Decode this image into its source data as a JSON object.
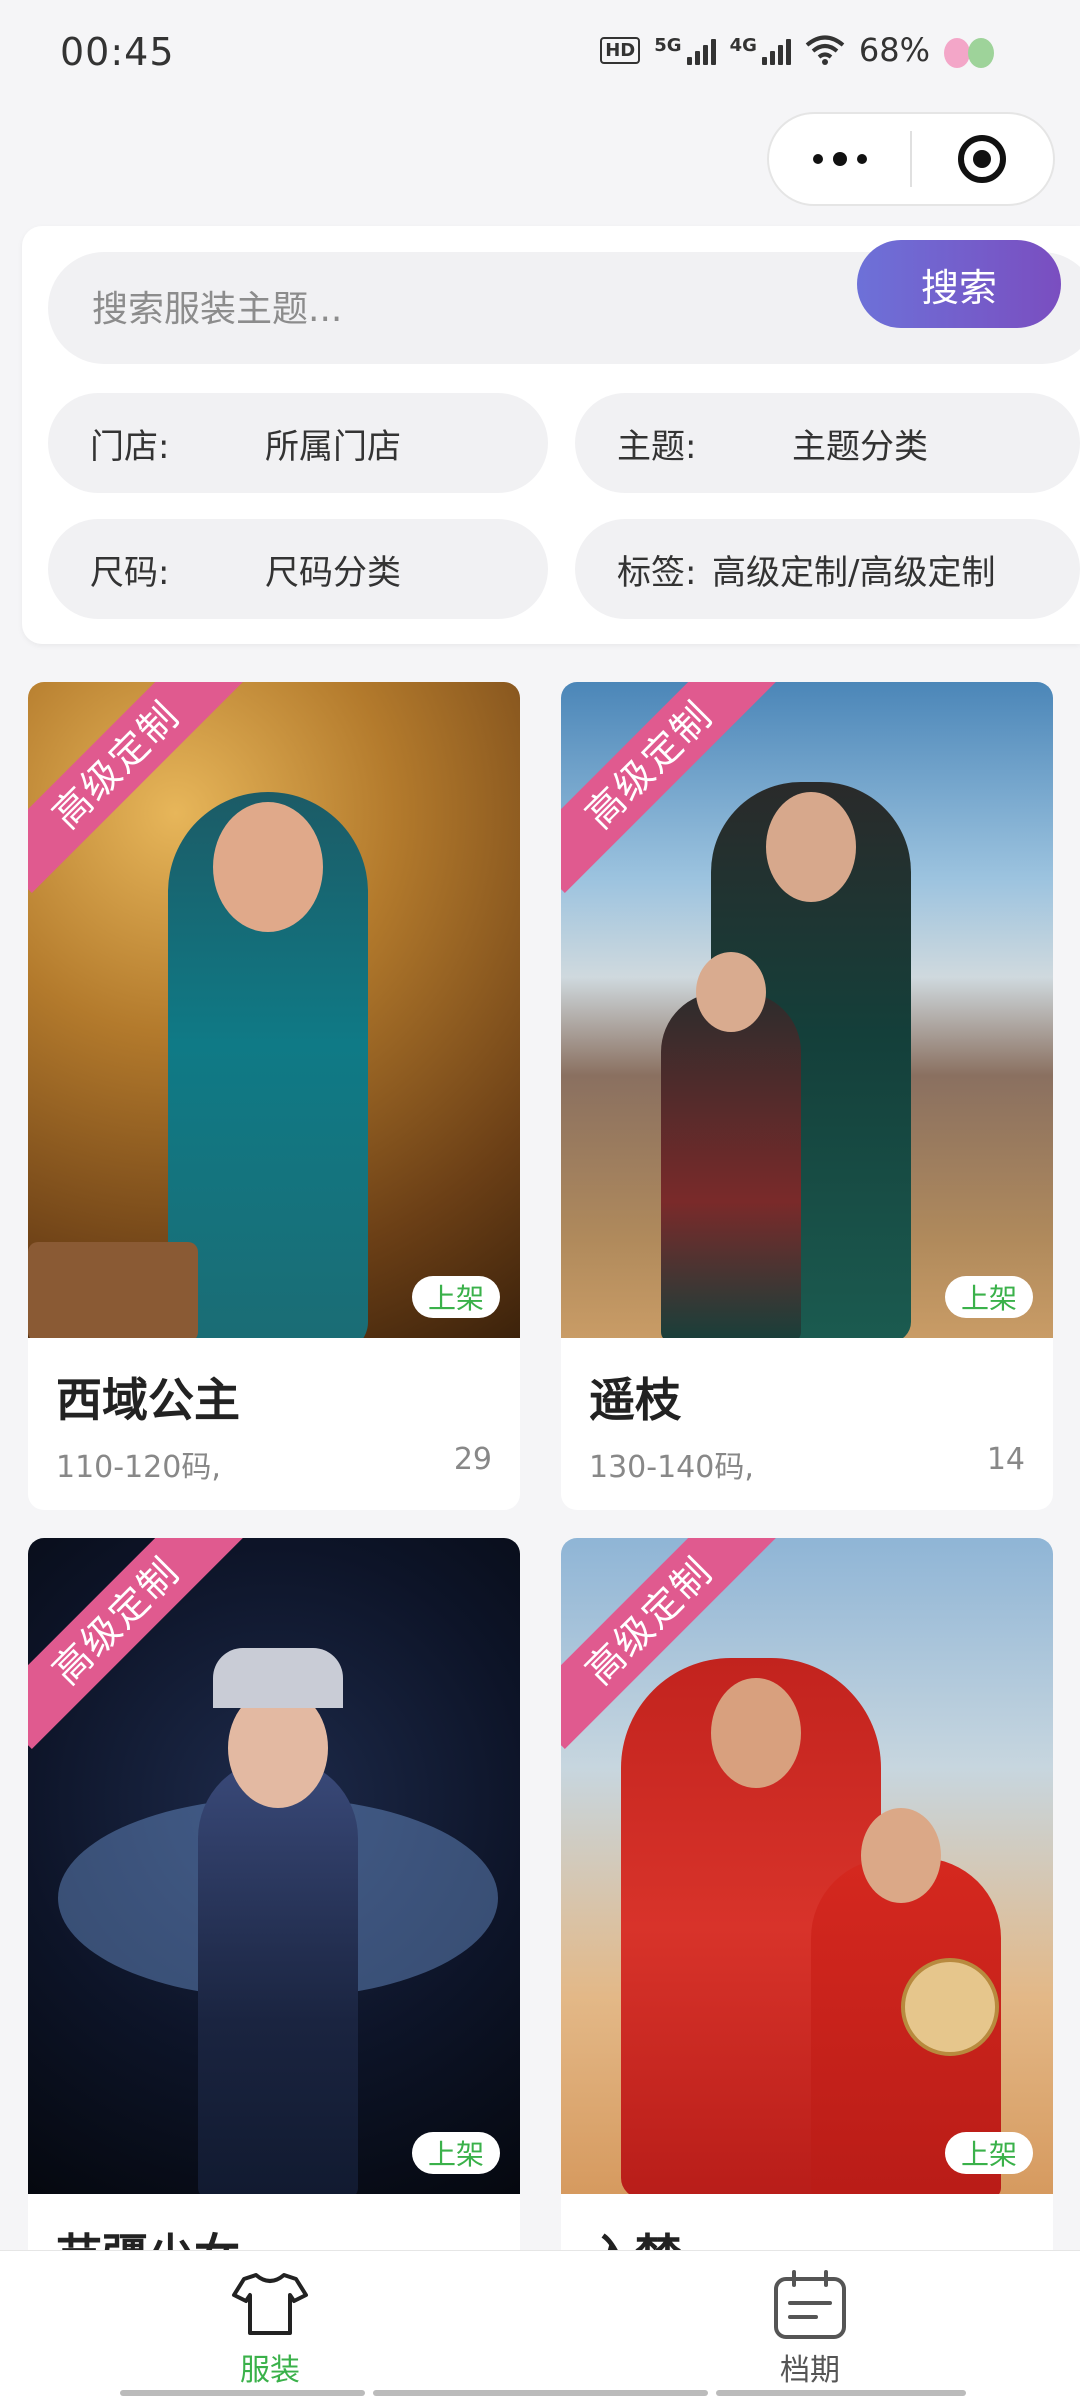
{
  "status_bar": {
    "time": "00:45",
    "hd": "HD",
    "net1": "5G",
    "net2": "4G",
    "battery": "68%"
  },
  "search": {
    "placeholder": "搜索服装主题...",
    "button_label": "搜索"
  },
  "filters": [
    {
      "key": "门店:",
      "value": "所属门店"
    },
    {
      "key": "主题:",
      "value": "主题分类"
    },
    {
      "key": "尺码:",
      "value": "尺码分类"
    },
    {
      "key": "标签:",
      "value": "高级定制/高级定制"
    }
  ],
  "cards": [
    {
      "ribbon": "高级定制",
      "status": "上架",
      "name": "西域公主",
      "size": "110-120码,",
      "count": "29"
    },
    {
      "ribbon": "高级定制",
      "status": "上架",
      "name": "遥枝",
      "size": "130-140码,",
      "count": "14"
    },
    {
      "ribbon": "高级定制",
      "status": "上架",
      "name": "苗疆少女",
      "size": "",
      "count": ""
    },
    {
      "ribbon": "高级定制",
      "status": "上架",
      "name": "入梦",
      "size": "",
      "count": ""
    }
  ],
  "tabbar": {
    "items": [
      {
        "label": "服装",
        "icon": "shirt-icon",
        "active": true
      },
      {
        "label": "档期",
        "icon": "calendar-icon",
        "active": false
      }
    ]
  },
  "colors": {
    "accent_green": "#3ab14a",
    "ribbon_pink": "#e05a8f",
    "search_button_start": "#6d71d8",
    "search_button_end": "#7a4ec0"
  }
}
